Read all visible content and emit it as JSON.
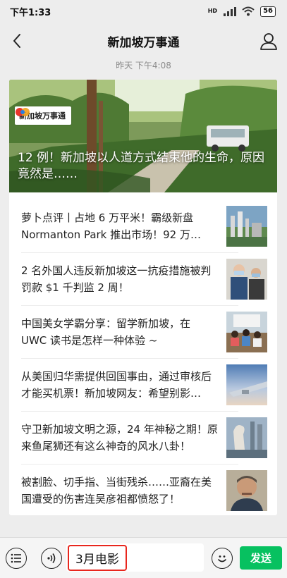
{
  "status_bar": {
    "time": "下午1:33",
    "network_label": "HD",
    "battery": "56"
  },
  "nav": {
    "title": "新加坡万事通"
  },
  "message": {
    "timestamp": "昨天 下午4:08",
    "cover": {
      "badge_text": "新加坡万事通",
      "title": "12 例！新加坡以人道方式结束他的生命，原因竟然是……"
    },
    "articles": [
      {
        "title": "萝卜点评丨占地 6 万平米！霸级新盘 Normanton Park 推出市场！92 万…",
        "thumb": "aerial-city-thumbnail"
      },
      {
        "title": "2 名外国人违反新加坡这一抗疫措施被判罚款 $1 千判监 2 周！",
        "thumb": "people-with-masks-thumbnail"
      },
      {
        "title": "中国美女学霸分享：留学新加坡，在 UWC 读书是怎样一种体验 ~",
        "thumb": "classroom-thumbnail"
      },
      {
        "title": "从美国归华需提供回国事由，通过审核后才能买机票！新加坡网友：希望别影…",
        "thumb": "airplane-wing-thumbnail"
      },
      {
        "title": "守卫新加坡文明之源，24 年神秘之期！原来鱼尾狮还有这么神奇的风水八卦！",
        "thumb": "merlion-thumbnail"
      },
      {
        "title": "被割脸、切手指、当街残杀……亚裔在美国遭受的伤害连吴彦祖都愤怒了！",
        "thumb": "man-portrait-thumbnail"
      }
    ]
  },
  "input_bar": {
    "input_value": "3月电影",
    "send_label": "发送"
  },
  "colors": {
    "send_green": "#07c160",
    "highlight_red": "#e8261d",
    "background": "#ededed"
  }
}
